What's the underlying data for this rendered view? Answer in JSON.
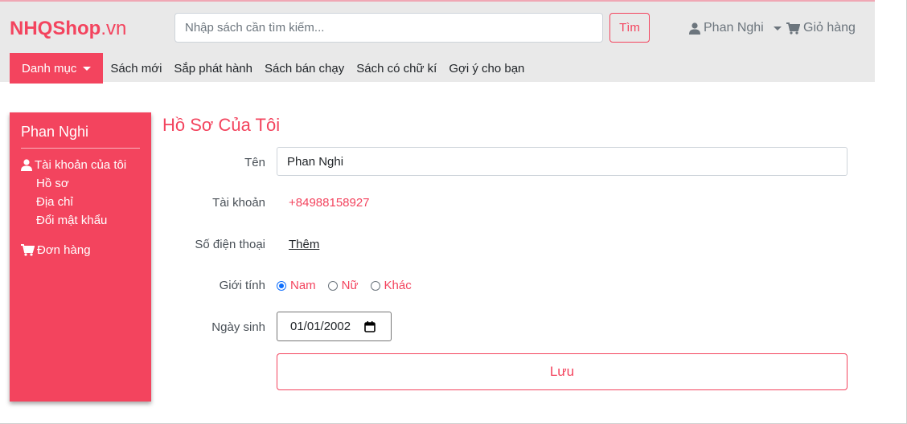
{
  "header": {
    "logo_bold": "NHQShop",
    "logo_suffix": ".vn",
    "search_placeholder": "Nhập sách cần tìm kiếm...",
    "search_button": "Tìm",
    "user_name": "Phan Nghi",
    "cart_label": "Giỏ hàng"
  },
  "nav": {
    "category_label": "Danh mục",
    "links": [
      "Sách mới",
      "Sắp phát hành",
      "Sách bán chạy",
      "Sách có chữ kí",
      "Gợi ý cho bạn"
    ]
  },
  "sidebar": {
    "user_name": "Phan Nghi",
    "account_label": "Tài khoản của tôi",
    "sub_items": [
      "Hồ sơ",
      "Địa chỉ",
      "Đổi mật khẩu"
    ],
    "orders_label": "Đơn hàng"
  },
  "profile": {
    "title": "Hồ Sơ Của Tôi",
    "name_label": "Tên",
    "name_value": "Phan Nghi",
    "account_label": "Tài khoản",
    "account_value": "+84988158927",
    "phone_label": "Số điện thoại",
    "phone_add": "Thêm",
    "gender_label": "Giới tính",
    "gender_options": [
      "Nam",
      "Nữ",
      "Khác"
    ],
    "gender_selected": "Nam",
    "birthday_label": "Ngày sinh",
    "birthday_value": "01/01/2002",
    "save_button": "Lưu"
  },
  "colors": {
    "accent": "#f3445e",
    "header_bg": "#e9e9e9",
    "radio_checked": "#0d6efd"
  }
}
